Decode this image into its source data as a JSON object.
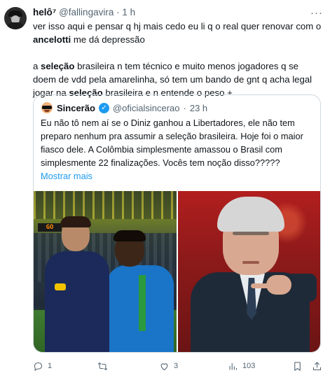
{
  "author": {
    "name": "helô⁷",
    "handle": "@fallingavira",
    "separator": "·",
    "time": "1 h"
  },
  "more_label": "···",
  "text": {
    "p1_before": "ver isso aqui e pensar q hj mais cedo eu li q o real quer renovar com o ",
    "p1_bold": "ancelotti",
    "p1_after": " me dá depressão",
    "p2_a": "a ",
    "p2_bold1": "seleção",
    "p2_b": " brasileira n tem técnico e muito menos jogadores q se doem de vdd pela amarelinha, só tem um bando de gnt q acha legal jogar na ",
    "p2_bold2": "seleção",
    "p2_c": " brasileira e n entende o peso +"
  },
  "quote": {
    "name": "Sincerão",
    "verified_mark": "✓",
    "handle": "@oficialsincerao",
    "separator": "·",
    "time": "23 h",
    "text": "Eu não tô nem aí se o Diniz ganhou a Libertadores, ele não tem preparo nenhum pra assumir a seleção brasileira. Hoje foi o maior fiasco dele. A Colômbia simplesmente amassou o Brasil com simplesmente 22 finalizações. Vocês tem noção disso?????",
    "ellipsis": "...",
    "show_more": "Mostrar mais",
    "scoreboard": "GO"
  },
  "actions": {
    "reply_count": "1",
    "retweet_count": "",
    "like_count": "3",
    "views_count": "103"
  },
  "icons": [
    "reply-icon",
    "retweet-icon",
    "like-icon",
    "views-icon",
    "bookmark-icon",
    "share-icon",
    "verified-icon"
  ],
  "colors": {
    "accent": "#1d9bf0",
    "secondary_text": "#536471",
    "border": "#cfd9de"
  }
}
